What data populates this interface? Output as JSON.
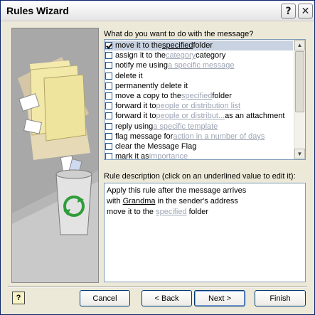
{
  "window": {
    "title": "Rules Wizard",
    "help_glyph": "?",
    "close_glyph": "✕"
  },
  "actions_prompt": "What do you want to do with the message?",
  "actions": [
    {
      "checked": true,
      "selected": true,
      "parts": [
        "move it to the ",
        "specified",
        " folder"
      ],
      "link_index": 1
    },
    {
      "checked": false,
      "selected": false,
      "parts": [
        "assign it to the ",
        "category",
        " category"
      ],
      "link_index": 1
    },
    {
      "checked": false,
      "selected": false,
      "parts": [
        "notify me using ",
        "a specific message",
        ""
      ],
      "link_index": 1
    },
    {
      "checked": false,
      "selected": false,
      "parts": [
        "delete it",
        "",
        ""
      ],
      "link_index": -1
    },
    {
      "checked": false,
      "selected": false,
      "parts": [
        "permanently delete it",
        "",
        ""
      ],
      "link_index": -1
    },
    {
      "checked": false,
      "selected": false,
      "parts": [
        "move a copy to the ",
        "specified",
        " folder"
      ],
      "link_index": 1
    },
    {
      "checked": false,
      "selected": false,
      "parts": [
        "forward it to ",
        "people or distribution list",
        ""
      ],
      "link_index": 1
    },
    {
      "checked": false,
      "selected": false,
      "parts": [
        "forward it to ",
        "people or distribut...",
        " as an attachment"
      ],
      "link_index": 1
    },
    {
      "checked": false,
      "selected": false,
      "parts": [
        "reply using ",
        "a specific template",
        ""
      ],
      "link_index": 1
    },
    {
      "checked": false,
      "selected": false,
      "parts": [
        "flag message for ",
        "action in a number of days",
        ""
      ],
      "link_index": 1
    },
    {
      "checked": false,
      "selected": false,
      "parts": [
        "clear the Message Flag",
        "",
        ""
      ],
      "link_index": -1
    },
    {
      "checked": false,
      "selected": false,
      "parts": [
        "mark it as ",
        "importance",
        ""
      ],
      "link_index": 1
    }
  ],
  "description_prompt": "Rule description (click on an underlined value to edit it):",
  "description_lines": [
    {
      "before": "Apply this rule after the message arrives",
      "link": "",
      "after": ""
    },
    {
      "before": "with ",
      "link": "Grandma",
      "after": " in the sender's address",
      "link_dark": true
    },
    {
      "before": "move it to the ",
      "link": "specified",
      "after": " folder"
    }
  ],
  "buttons": {
    "cancel": "Cancel",
    "back": "< Back",
    "next": "Next >",
    "finish": "Finish"
  },
  "help_button_glyph": "?",
  "scroll": {
    "up_glyph": "▲",
    "down_glyph": "▼"
  }
}
